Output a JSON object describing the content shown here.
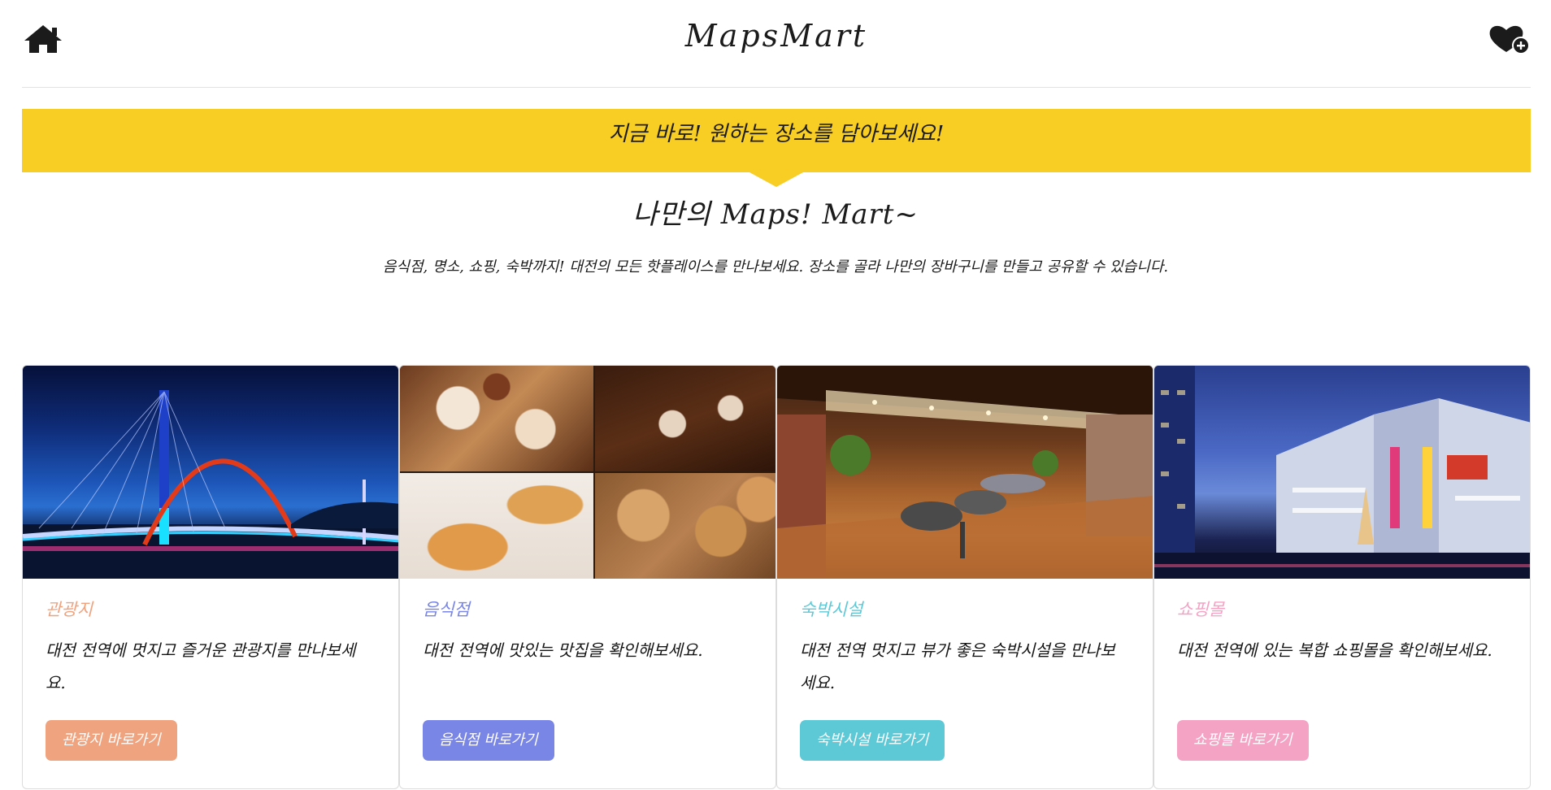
{
  "header": {
    "brand": "MapsMart",
    "home_icon": "home-icon",
    "wishlist_icon": "heart-plus-icon"
  },
  "banner": {
    "text": "지금 바로! 원하는 장소를 담아보세요!",
    "color": "#f8cd24"
  },
  "hero": {
    "title": "나만의 Maps! Mart~",
    "description": "음식점, 명소, 쇼핑, 숙박까지! 대전의 모든 핫플레이스를 만나보세요. 장소를 골라 나만의 장바구니를 만들고 공유할 수 있습니다."
  },
  "cards": [
    {
      "category": "관광지",
      "text": "대전 전역에 멋지고 즐거운 관광지를 만나보세요.",
      "button": "관광지 바로가기",
      "color": "#f0a37f"
    },
    {
      "category": "음식점",
      "text": "대전 전역에 맛있는 맛집을 확인해보세요.",
      "button": "음식점 바로가기",
      "color": "#7a86e6"
    },
    {
      "category": "숙박시설",
      "text": "대전 전역 멋지고 뷰가 좋은 숙박시설을 만나보세요.",
      "button": "숙박시설 바로가기",
      "color": "#5ec9d6"
    },
    {
      "category": "쇼핑몰",
      "text": "대전 전역에 있는 복합 쇼핑몰을 확인해보세요.",
      "button": "쇼핑몰 바로가기",
      "color": "#f5a3c4"
    }
  ]
}
